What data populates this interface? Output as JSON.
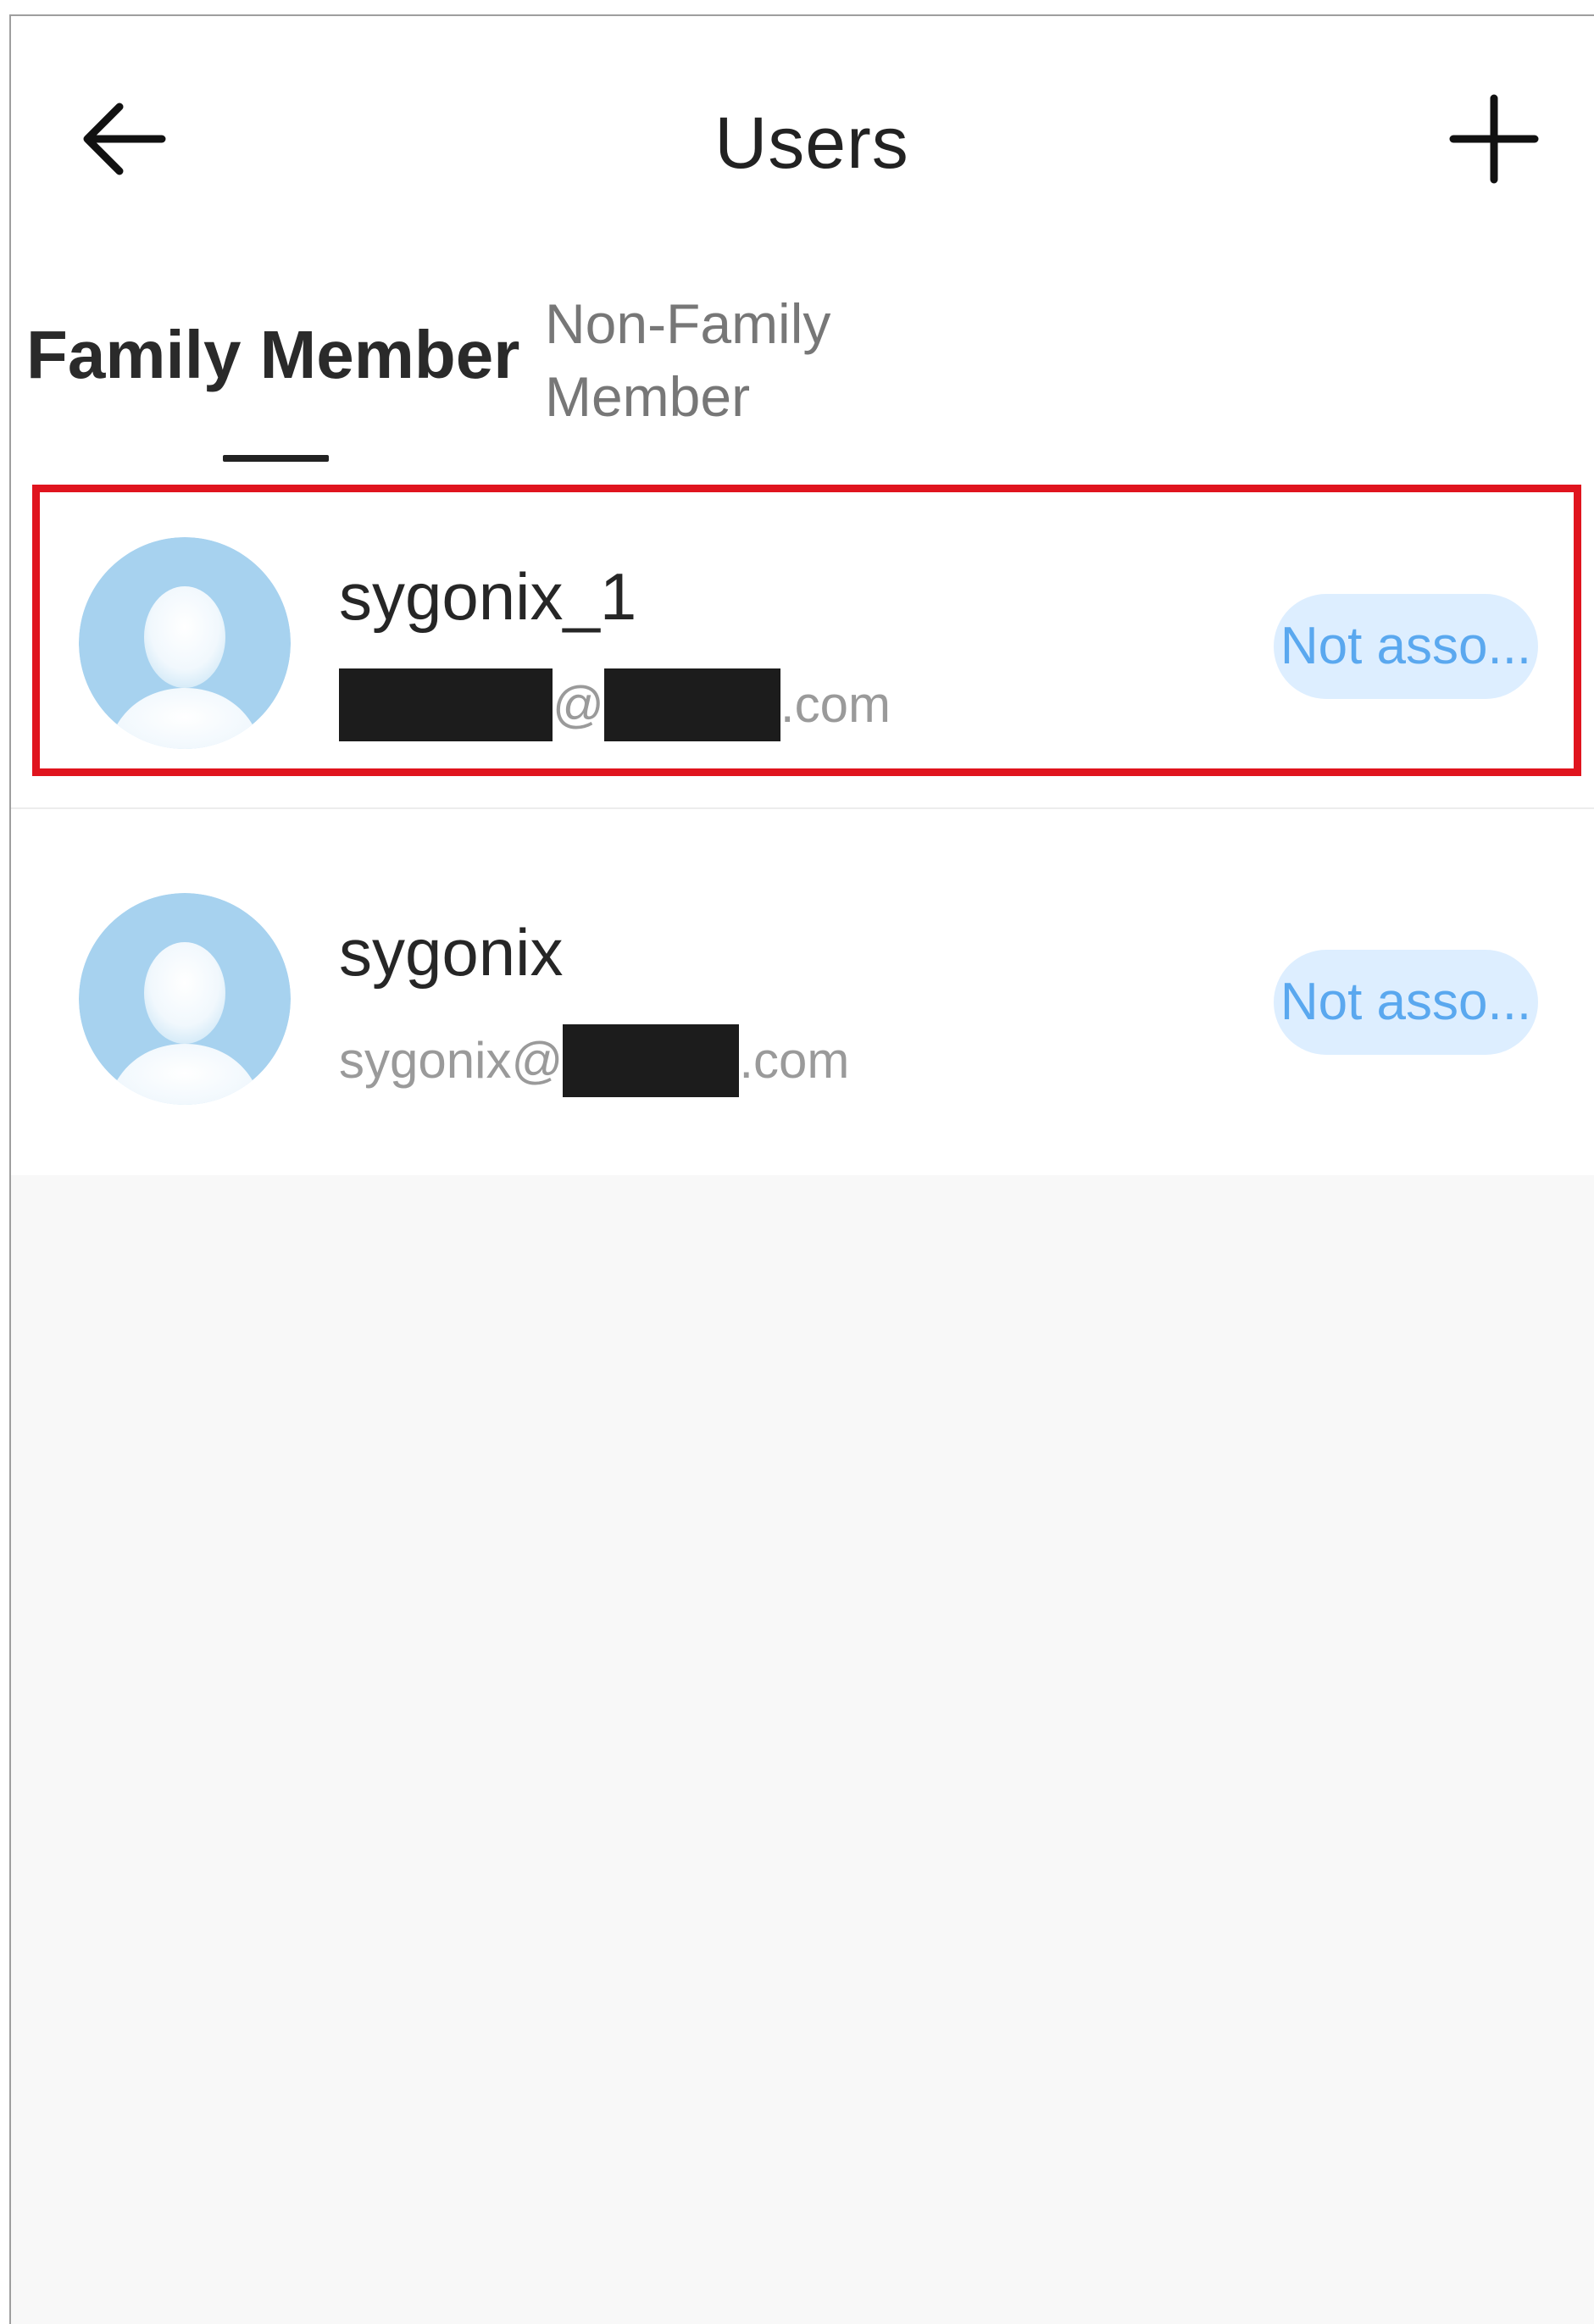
{
  "header": {
    "title": "Users",
    "back_icon": "arrow-left-icon",
    "add_icon": "plus-icon"
  },
  "tabs": [
    {
      "label": "Family Member",
      "active": true
    },
    {
      "label": "Non-Family Member",
      "active": false
    }
  ],
  "users": [
    {
      "name": "sygonix_1",
      "email": {
        "local_visible": "",
        "at": "@",
        "domain_visible": "",
        "tld": ".com"
      },
      "status": "Not asso...",
      "highlighted": true
    },
    {
      "name": "sygonix",
      "email": {
        "local_visible": "sygonix",
        "at": "@",
        "domain_visible": "",
        "tld": ".com"
      },
      "status": "Not asso...",
      "highlighted": false
    }
  ],
  "colors": {
    "highlight": "#e0141e",
    "badge_bg": "#ddeeff",
    "badge_text": "#5aa8ef",
    "avatar_bg": "#a7d2ef"
  }
}
